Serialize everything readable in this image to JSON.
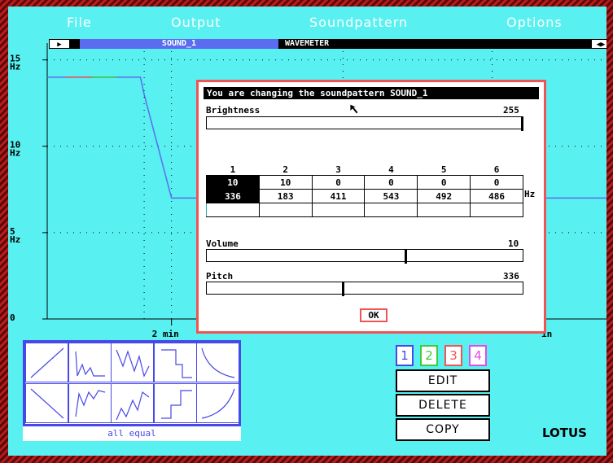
{
  "menu": {
    "items": [
      "File",
      "Output",
      "Soundpattern",
      "Options"
    ]
  },
  "strip": {
    "left_arrow": "▶",
    "sound_name": "SOUND_1",
    "view_name": "WAVEMETER",
    "right_arrow": "◀▶"
  },
  "chart": {
    "y_ticks": [
      {
        "value": "15",
        "unit": "Hz"
      },
      {
        "value": "10",
        "unit": "Hz"
      },
      {
        "value": "5",
        "unit": "Hz"
      },
      {
        "value": "0",
        "unit": ""
      }
    ],
    "x_ticks": [
      "2 min",
      "in"
    ],
    "colors": {
      "line": "#5c6cf0",
      "segment_a": "#f05454",
      "segment_b": "#3ccc3c"
    }
  },
  "chart_data": {
    "type": "line",
    "title": "",
    "xlabel": "",
    "ylabel": "",
    "ylim": [
      0,
      15.5
    ],
    "series": [
      {
        "x_minutes": [
          0,
          0.75,
          0.78,
          1,
          4.5
        ],
        "values": [
          14,
          14,
          13,
          7,
          7
        ]
      }
    ],
    "x_tick_labels": [
      "2 min",
      "in"
    ],
    "y_tick_labels": [
      "15 Hz",
      "10 Hz",
      "5 Hz",
      "0"
    ],
    "grid": true
  },
  "dialog": {
    "title": "You are changing the soundpattern SOUND_1",
    "brightness_label": "Brightness",
    "brightness_value": "255",
    "brightness_level": 1.0,
    "tones": {
      "headers": [
        "1",
        "2",
        "3",
        "4",
        "5",
        "6"
      ],
      "levels": [
        "10",
        "10",
        "0",
        "0",
        "0",
        "0"
      ],
      "freqs": [
        "336",
        "183",
        "411",
        "543",
        "492",
        "486"
      ],
      "selected_index": 0,
      "unit": "Hz"
    },
    "volume_label": "Volume",
    "volume_value": "10",
    "volume_level": 0.63,
    "pitch_label": "Pitch",
    "pitch_value": "336",
    "pitch_level": 0.43,
    "ok_label": "OK"
  },
  "palette": {
    "caption": "all equal",
    "patterns": [
      "ramp-up-icon",
      "decay-jagged-icon",
      "zigzag-icon",
      "step-down-icon",
      "exp-decay-icon",
      "ramp-down-icon",
      "rise-jagged-icon",
      "zigzag-rise-icon",
      "step-up-icon",
      "exp-rise-icon"
    ]
  },
  "channels": {
    "tabs": [
      {
        "label": "1",
        "color": "#4848e8"
      },
      {
        "label": "2",
        "color": "#3ccc3c"
      },
      {
        "label": "3",
        "color": "#f05454"
      },
      {
        "label": "4",
        "color": "#e848e8"
      }
    ],
    "actions": [
      "EDIT",
      "DELETE",
      "COPY"
    ]
  },
  "brand": "LOTUS"
}
